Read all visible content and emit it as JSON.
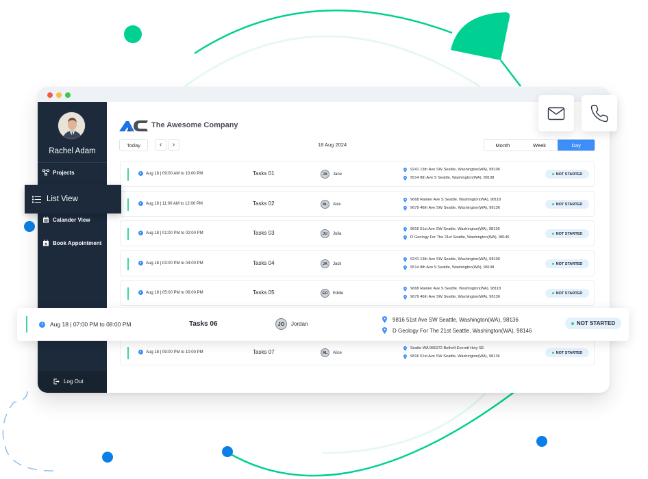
{
  "user": {
    "name": "Rachel Adam"
  },
  "sidebar": {
    "items": [
      {
        "label": "Projects",
        "icon": "projects-icon"
      },
      {
        "label": "List View",
        "icon": "list-icon",
        "active": true
      },
      {
        "label": "Calander View",
        "icon": "calendar-icon"
      },
      {
        "label": "Book Appointment",
        "icon": "calendar-plus-icon"
      }
    ],
    "logout_label": "Log Out"
  },
  "header": {
    "company_name": "The Awesome Company",
    "today_label": "Today",
    "prev_label": "‹",
    "next_label": "›",
    "current_date": "18 Aug 2024",
    "views": [
      "Month",
      "Week",
      "Day"
    ],
    "active_view": "Day"
  },
  "contact": {
    "email_icon": "mail-icon",
    "phone_icon": "phone-icon"
  },
  "colors": {
    "accent": "#3d8ef8",
    "sidebar": "#1c2a3c",
    "green": "#00d092",
    "status_bg": "#e4f1fd"
  },
  "tasks": [
    {
      "time": "Aug 18 | 09:00 AM to 10:00 PM",
      "name": "Tasks 01",
      "initials": "JA",
      "assignee": "Jane",
      "address1": "9241 13th Ave SW Seattle, Washington(WA), 98106",
      "address2": "9514 8th Ave S Seattle, Washington(WA), 98108",
      "status": "NOT STARTED"
    },
    {
      "time": "Aug 18 | 11:00 AM to 12:00 PM",
      "name": "Tasks 02",
      "initials": "AL",
      "assignee": "Alex",
      "address1": "9668 Rainier Ave S Seattle, Washington(WA), 98118",
      "address2": "9679 46th Ave SW Seattle, Washington(WA), 98136",
      "status": "NOT STARTED"
    },
    {
      "time": "Aug 18 | 01:00 PM to 02:00 PM",
      "name": "Tasks 03",
      "initials": "JU",
      "assignee": "Julia",
      "address1": "9816 51st Ave SW Seattle, Washington(WA), 98136",
      "address2": "D Geology For The 21st Seattle, Washington(WA), 98146",
      "status": "NOT STARTED"
    },
    {
      "time": "Aug 18 | 03:00 PM to 04:00 PM",
      "name": "Tasks 04",
      "initials": "JA",
      "assignee": "Jack",
      "address1": "9241 13th Ave SW Seattle, Washington(WA), 98106",
      "address2": "9514 8th Ave S Seattle, Washington(WA), 98108",
      "status": "NOT STARTED"
    },
    {
      "time": "Aug 18 | 05:00 PM to 06:00 PM",
      "name": "Tasks 05",
      "initials": "ED",
      "assignee": "Eddie",
      "address1": "9668 Rainier Ave S Seattle, Washington(WA), 98118",
      "address2": "9679 46th Ave SW Seattle, Washington(WA), 98136",
      "status": "NOT STARTED"
    },
    {
      "time": "Aug 18 | 07:00 PM to 08:00 PM",
      "name": "Tasks 06",
      "initials": "JO",
      "assignee": "Jordan",
      "address1": "9816 51st Ave SW Seattle, Washington(WA), 98136",
      "address2": "D Geology For The 21st Seattle, Washington(WA), 98146",
      "status": "NOT STARTED"
    },
    {
      "time": "Aug 18 | 09:00 PM to 10:00 PM",
      "name": "Tasks 07",
      "initials": "AL",
      "assignee": "Alice",
      "address1": "Seatle WA 981072 Bothell-Everett Hwy SE",
      "address2": "9816 51st Ave SW Seattle, Washington(WA), 98136",
      "status": "NOT STARTED"
    }
  ]
}
